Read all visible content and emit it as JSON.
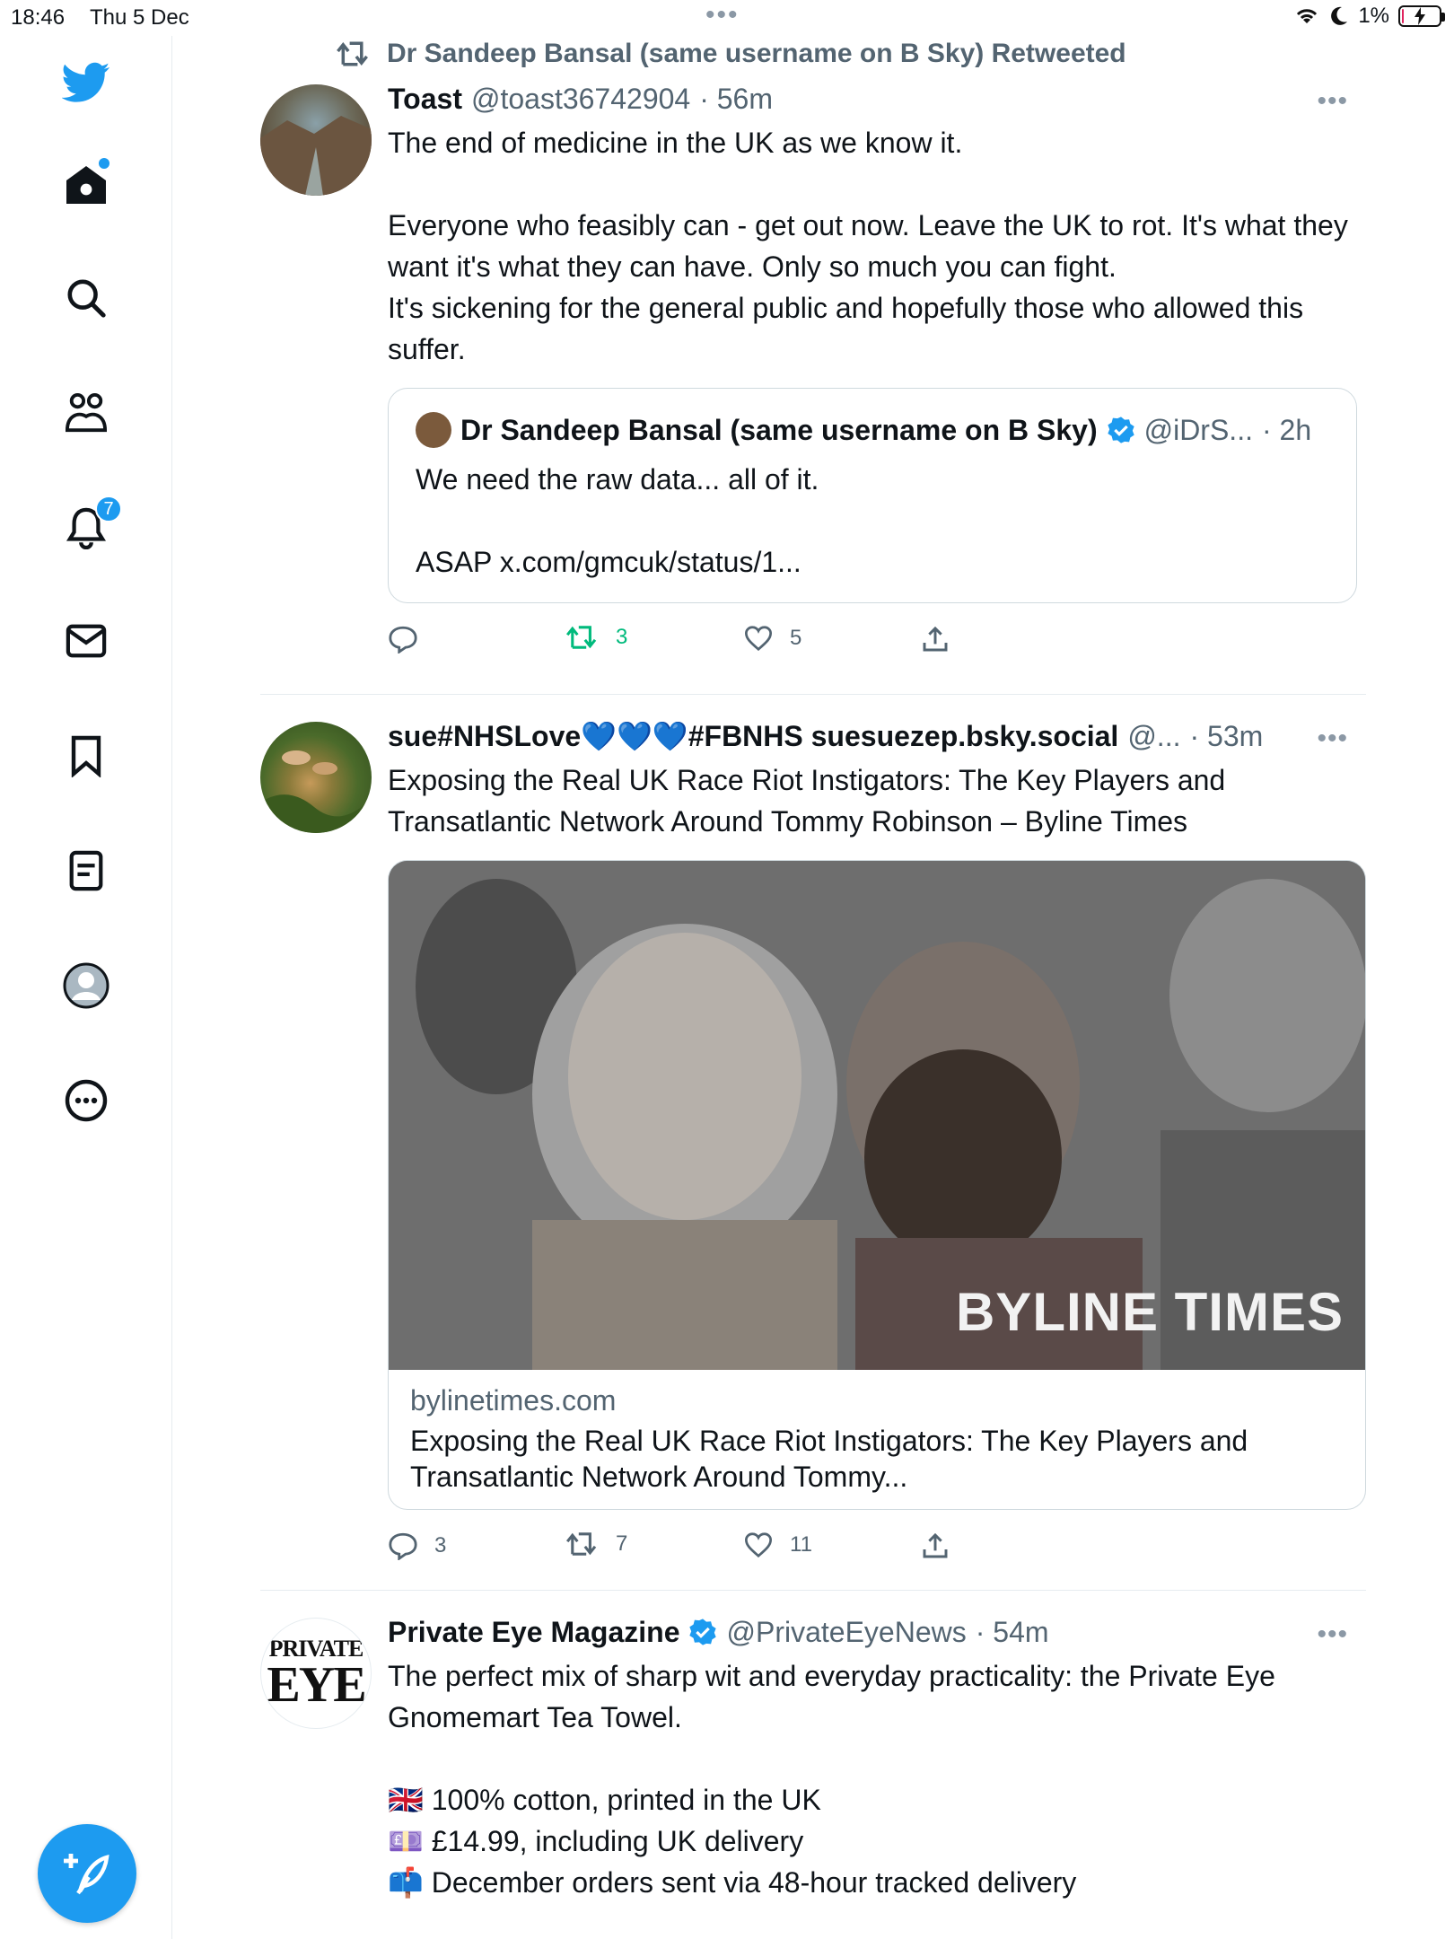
{
  "status_bar": {
    "time": "18:46",
    "date": "Thu 5 Dec",
    "battery": "1%",
    "battery_level": 0.01
  },
  "sidebar": {
    "notifications_badge": "7"
  },
  "retweet_banner": "Dr Sandeep Bansal (same username on B Sky) Retweeted",
  "tweets": [
    {
      "name": "Toast",
      "handle": "@toast36742904",
      "time": "· 56m",
      "text": [
        "The end of medicine in the UK as we know it.",
        "",
        "Everyone who feasibly can - get out now. Leave the UK to rot. It's what they want  it's what they can have. Only so much you can fight.",
        "It's sickening for the general public and hopefully those who allowed this suffer."
      ],
      "quote": {
        "name": "Dr Sandeep Bansal (same username on B Sky)",
        "handle": "@iDrS...",
        "time": "· 2h",
        "text": [
          "We need the raw data... all of it.",
          "",
          "ASAP x.com/gmcuk/status/1..."
        ]
      },
      "replies": "",
      "retweets": "3",
      "likes": "5"
    },
    {
      "name": "sue#NHSLove💙💙💙#FBNHS suesuezep.bsky.social",
      "handle": "@...",
      "time": "· 53m",
      "text": [
        "Exposing the Real UK Race Riot Instigators: The Key Players and Transatlantic Network Around Tommy Robinson – Byline Times"
      ],
      "card": {
        "watermark": "BYLINE TIMES",
        "domain": "bylinetimes.com",
        "title": "Exposing the Real UK Race Riot Instigators: The Key Players and Transatlantic Network Around Tommy..."
      },
      "replies": "3",
      "retweets": "7",
      "likes": "11"
    },
    {
      "name": "Private Eye Magazine",
      "handle": "@PrivateEyeNews",
      "time": "· 54m",
      "avatar_text": [
        "PRIVATE",
        "EYE"
      ],
      "text": [
        "The perfect mix of sharp wit and everyday practicality: the Private Eye Gnomemart Tea Towel.",
        "",
        "🇬🇧 100% cotton, printed in the UK",
        "💷 £14.99, including UK delivery",
        "📫 December orders sent via 48-hour tracked delivery"
      ]
    }
  ],
  "colors": {
    "accent": "#1d9bf0",
    "retweet_green": "#00ba7c",
    "secondary_text": "#536471"
  }
}
